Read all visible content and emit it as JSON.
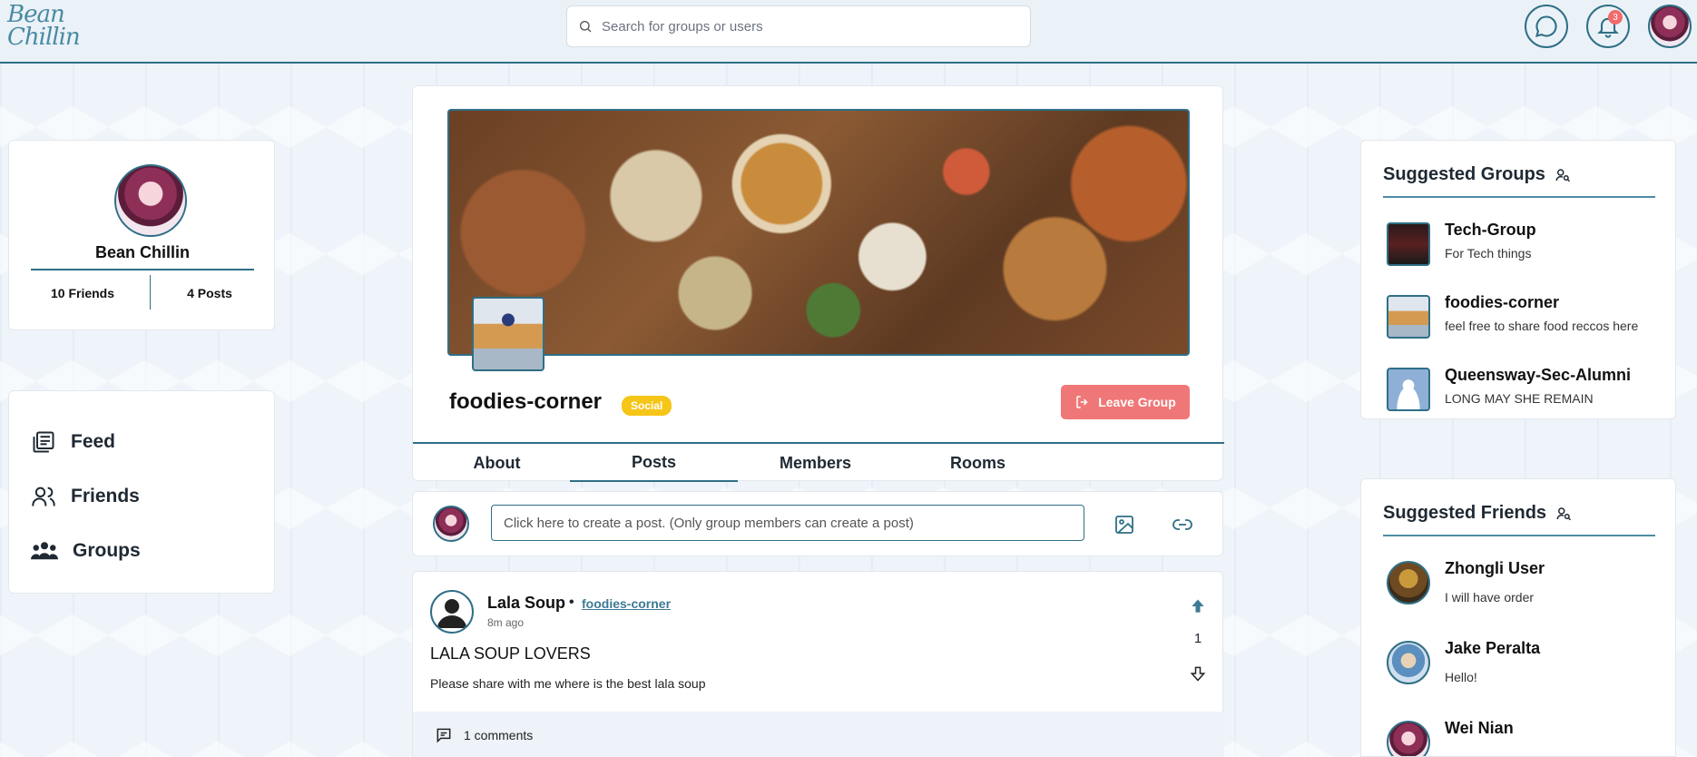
{
  "brand": {
    "logo_text": "Bean Chillin"
  },
  "search": {
    "placeholder": "Search for groups or users"
  },
  "header": {
    "notification_count": "3"
  },
  "profile": {
    "name": "Bean Chillin",
    "friends": "10 Friends",
    "posts": "4 Posts"
  },
  "nav": {
    "items": [
      {
        "label": "Feed"
      },
      {
        "label": "Friends"
      },
      {
        "label": "Groups"
      }
    ]
  },
  "group": {
    "name": "foodies-corner",
    "category": "Social",
    "leave_label": "Leave Group",
    "tabs": [
      {
        "label": "About"
      },
      {
        "label": "Posts"
      },
      {
        "label": "Members"
      },
      {
        "label": "Rooms"
      }
    ],
    "active_tab": "Posts"
  },
  "compose": {
    "placeholder": "Click here to create a post. (Only group members can create a post)"
  },
  "post": {
    "author": "Lala Soup",
    "group_link": "foodies-corner",
    "time": "8m ago",
    "title": "LALA SOUP LOVERS",
    "body": "Please share with me where is the best lala soup",
    "votes": "1",
    "comments": "1 comments"
  },
  "suggested_groups": {
    "title": "Suggested Groups",
    "items": [
      {
        "name": "Tech-Group",
        "desc": "For Tech things"
      },
      {
        "name": "foodies-corner",
        "desc": "feel free to share food reccos here"
      },
      {
        "name": "Queensway-Sec-Alumni",
        "desc": "LONG MAY SHE REMAIN"
      }
    ]
  },
  "suggested_friends": {
    "title": "Suggested Friends",
    "items": [
      {
        "name": "Zhongli User",
        "desc": "I will have order"
      },
      {
        "name": "Jake Peralta",
        "desc": "Hello!"
      },
      {
        "name": "Wei Nian",
        "desc": ""
      }
    ]
  },
  "colors": {
    "accent": "#2f6f86",
    "danger": "#f07777",
    "tag": "#f5c518"
  }
}
